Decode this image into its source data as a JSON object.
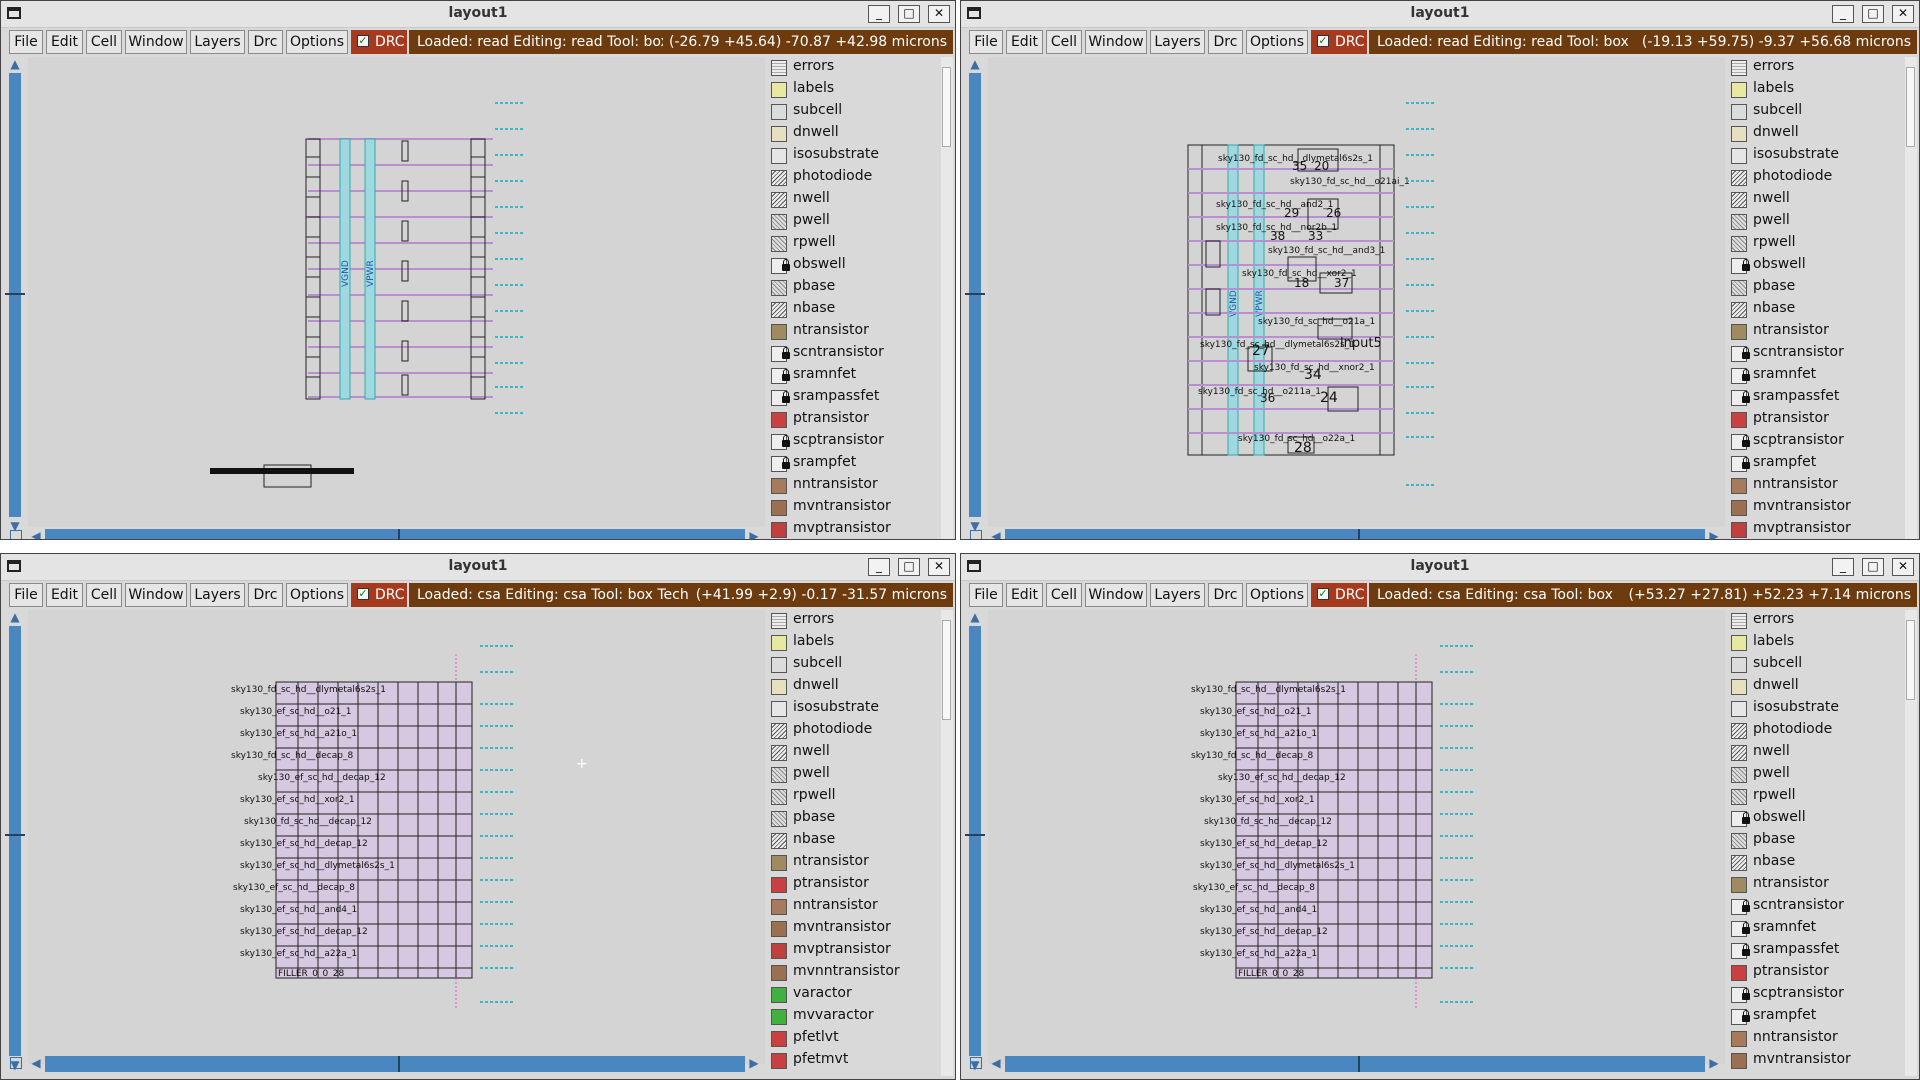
{
  "windows": [
    {
      "title": "layout1",
      "status": "Loaded: read Editing: read Tool: box",
      "coords": "(-26.79 +45.64) -70.87 +42.98 microns",
      "layers": [
        "errors",
        "labels",
        "subcell",
        "dnwell",
        "isosubstrate",
        "photodiode",
        "nwell",
        "pwell",
        "rpwell",
        "obswell",
        "pbase",
        "nbase",
        "ntransistor",
        "scntransistor",
        "sramnfet",
        "srampassfet",
        "ptransistor",
        "scptransistor",
        "srampfet",
        "nntransistor",
        "mvntransistor",
        "mvptransistor"
      ]
    },
    {
      "title": "layout1",
      "status": "Loaded: read Editing: read Tool: box",
      "coords": "(-19.13 +59.75) -9.37 +56.68 microns",
      "layers": [
        "errors",
        "labels",
        "subcell",
        "dnwell",
        "isosubstrate",
        "photodiode",
        "nwell",
        "pwell",
        "rpwell",
        "obswell",
        "pbase",
        "nbase",
        "ntransistor",
        "scntransistor",
        "sramnfet",
        "srampassfet",
        "ptransistor",
        "scptransistor",
        "srampfet",
        "nntransistor",
        "mvntransistor",
        "mvptransistor"
      ]
    },
    {
      "title": "layout1",
      "status": "Loaded: csa Editing: csa Tool: box  Tech",
      "coords": "(+41.99 +2.9) -0.17 -31.57 microns",
      "layers": [
        "errors",
        "labels",
        "subcell",
        "dnwell",
        "isosubstrate",
        "photodiode",
        "nwell",
        "pwell",
        "rpwell",
        "pbase",
        "nbase",
        "ntransistor",
        "ptransistor",
        "nntransistor",
        "mvntransistor",
        "mvptransistor",
        "mvnntransistor",
        "varactor",
        "mvvaractor",
        "pfetlvt",
        "pfetmvt"
      ]
    },
    {
      "title": "layout1",
      "status": "Loaded: csa Editing: csa Tool: box",
      "coords": "(+53.27 +27.81) +52.23 +7.14 microns",
      "layers": [
        "errors",
        "labels",
        "subcell",
        "dnwell",
        "isosubstrate",
        "photodiode",
        "nwell",
        "pwell",
        "rpwell",
        "obswell",
        "pbase",
        "nbase",
        "ntransistor",
        "scntransistor",
        "sramnfet",
        "srampassfet",
        "ptransistor",
        "scptransistor",
        "srampfet",
        "nntransistor",
        "mvntransistor"
      ]
    }
  ],
  "menu": [
    "File",
    "Edit",
    "Cell",
    "Window",
    "Layers",
    "Drc",
    "Options"
  ],
  "drc_label": "DRC",
  "window_buttons": {
    "minimize": "_",
    "maximize": "□",
    "close": "✕"
  },
  "canvas_labels": {
    "vgnd": "VGND",
    "vpwr": "VPWR",
    "cells_w2": [
      "sky130_fd_sc_hd__dlymetal6s2s_1",
      "sky130_fd_sc_hd__o21ai_1",
      "sky130_fd_sc_hd__and2_1",
      "sky130_fd_sc_hd__nor2b_1",
      "sky130_fd_sc_hd__and3_1",
      "sky130_fd_sc_hd__xor2_1",
      "sky130_fd_sc_hd__o21a_1",
      "sky130_fd_sc_hd__dlymetal6s2s_1",
      "sky130_fd_sc_hd__xnor2_1",
      "sky130_fd_sc_hd__o211a_1",
      "sky130_fd_sc_hd__o22a_1"
    ],
    "nums_w2": [
      "35",
      "20",
      "26",
      "29",
      "38",
      "33",
      "18",
      "37",
      "27",
      "34",
      "36",
      "24",
      "28"
    ],
    "input5": "input5",
    "cells_w3": [
      "sky130_fd_sc_hd__dlymetal6s2s_1",
      "sky130_ef_sc_hd__o21_1",
      "sky130_ef_sc_hd__a21o_1",
      "sky130_fd_sc_hd__decap_8",
      "sky130_ef_sc_hd__decap_12",
      "sky130_ef_sc_hd__xor2_1",
      "sky130_fd_sc_hd__decap_12",
      "sky130_ef_sc_hd__decap_12",
      "sky130_ef_sc_hd__dlymetal6s2s_1",
      "sky130_ef_sc_hd__decap_8",
      "sky130_ef_sc_hd__and4_1",
      "sky130_ef_sc_hd__decap_12",
      "sky130_ef_sc_hd__a22a_1"
    ],
    "filler": "FILLER_0_0_28"
  }
}
